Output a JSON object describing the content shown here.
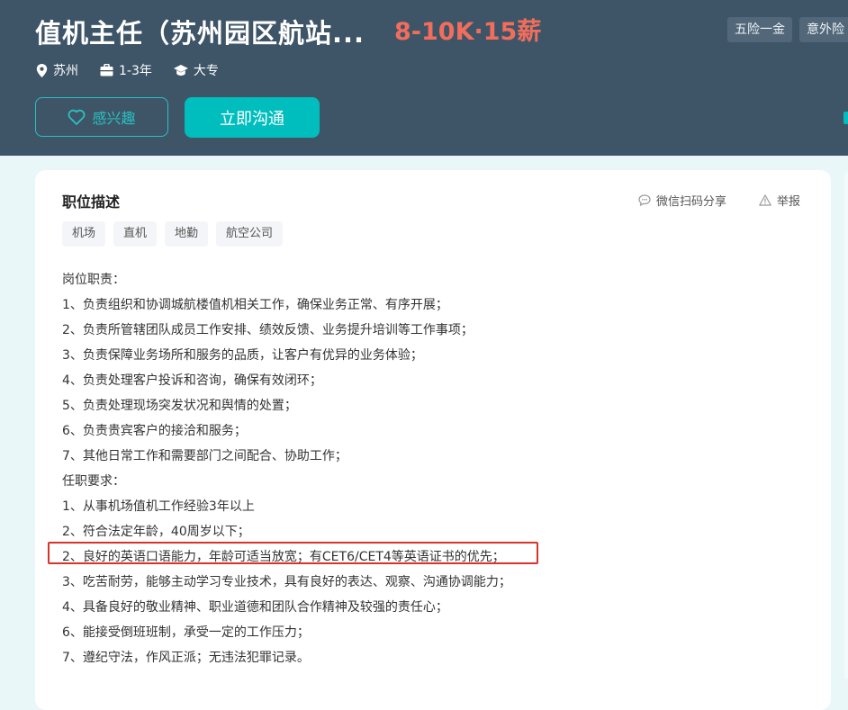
{
  "job": {
    "title": "值机主任（苏州园区航站...",
    "salary": "8-10K·15薪",
    "benefits": [
      "五险一金",
      "意外险"
    ],
    "meta": {
      "city": "苏州",
      "experience": "1-3年",
      "education": "大专"
    }
  },
  "actions": {
    "interest_label": "感兴趣",
    "chat_label": "立即沟通"
  },
  "section": {
    "title": "职位描述",
    "share_label": "微信扫码分享",
    "report_label": "举报",
    "tags": [
      "机场",
      "直机",
      "地勤",
      "航空公司"
    ]
  },
  "description": [
    "岗位职责：",
    "1、负责组织和协调城航楼值机相关工作，确保业务正常、有序开展；",
    "2、负责所管辖团队成员工作安排、绩效反馈、业务提升培训等工作事项；",
    "3、负责保障业务场所和服务的品质，让客户有优异的业务体验；",
    "4、负责处理客户投诉和咨询，确保有效闭环；",
    "5、负责处理现场突发状况和舆情的处置；",
    "6、负责贵宾客户的接洽和服务；",
    "7、其他日常工作和需要部门之间配合、协助工作；",
    "任职要求：",
    "1、从事机场值机工作经验3年以上",
    "2、符合法定年龄，40周岁以下；",
    "2、良好的英语口语能力，年龄可适当放宽；有CET6/CET4等英语证书的优先；",
    "3、吃苦耐劳，能够主动学习专业技术，具有良好的表达、观察、沟通协调能力；",
    "4、具备良好的敬业精神、职业道德和团队合作精神及较强的责任心；",
    "6、能接受倒班班制，承受一定的工作压力；",
    "7、遵纪守法，作风正派；无违法犯罪记录。"
  ],
  "colors": {
    "header_bg": "#3e5568",
    "accent": "#00bebd",
    "salary": "#f26d5b",
    "highlight": "#d9322b"
  }
}
